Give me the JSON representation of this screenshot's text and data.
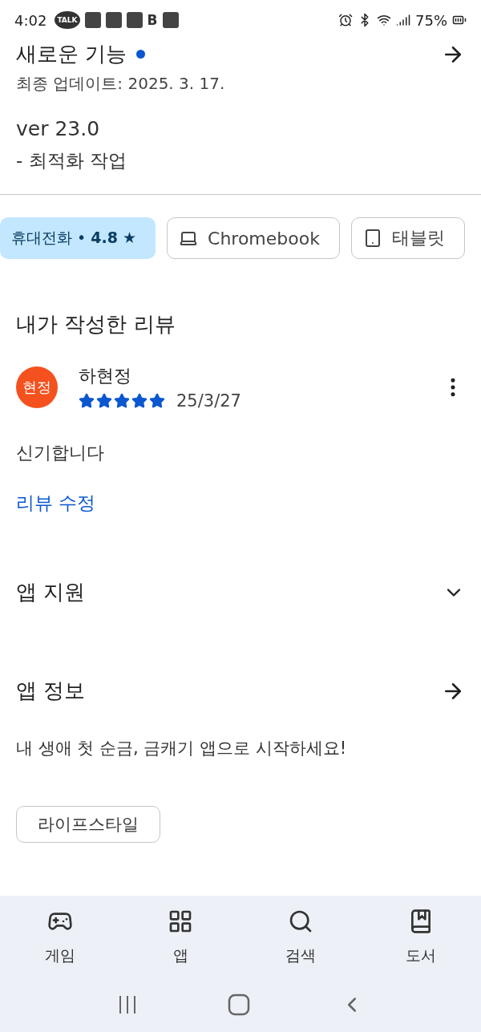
{
  "status_bar": {
    "time": "4:02",
    "talk_label": "TALK",
    "b_label": "B",
    "battery": "75%"
  },
  "whats_new": {
    "title": "새로운 기능",
    "unread": true,
    "updated": "최종 업데이트: 2025. 3. 17.",
    "version": "ver 23.0",
    "notes": "- 최적화 작업"
  },
  "device_chips": [
    {
      "kind": "phone",
      "label": "휴대전화 • **4.8** ★",
      "selected": true
    },
    {
      "kind": "laptop",
      "label": "Chromebook",
      "selected": false
    },
    {
      "kind": "tablet",
      "label": "태블릿",
      "selected": false
    }
  ],
  "my_review": {
    "heading": "내가 작성한 리뷰",
    "avatar": "현정",
    "author": "하현정",
    "stars": 5,
    "date": "25/3/27",
    "text": "신기합니다",
    "edit_link": "리뷰 수정"
  },
  "app_support": {
    "title": "앱 지원",
    "expanded": false
  },
  "app_info": {
    "title": "앱 정보",
    "description": "내 생애 첫 순금, 금캐기 앱으로 시작하세요!",
    "category": "라이프스타일"
  },
  "bottom_nav": [
    {
      "kind": "games",
      "label": "게임",
      "selected": false
    },
    {
      "kind": "apps",
      "label": "앱",
      "selected": false
    },
    {
      "kind": "search",
      "label": "검색",
      "selected": false
    },
    {
      "kind": "books",
      "label": "도서",
      "selected": false
    }
  ]
}
